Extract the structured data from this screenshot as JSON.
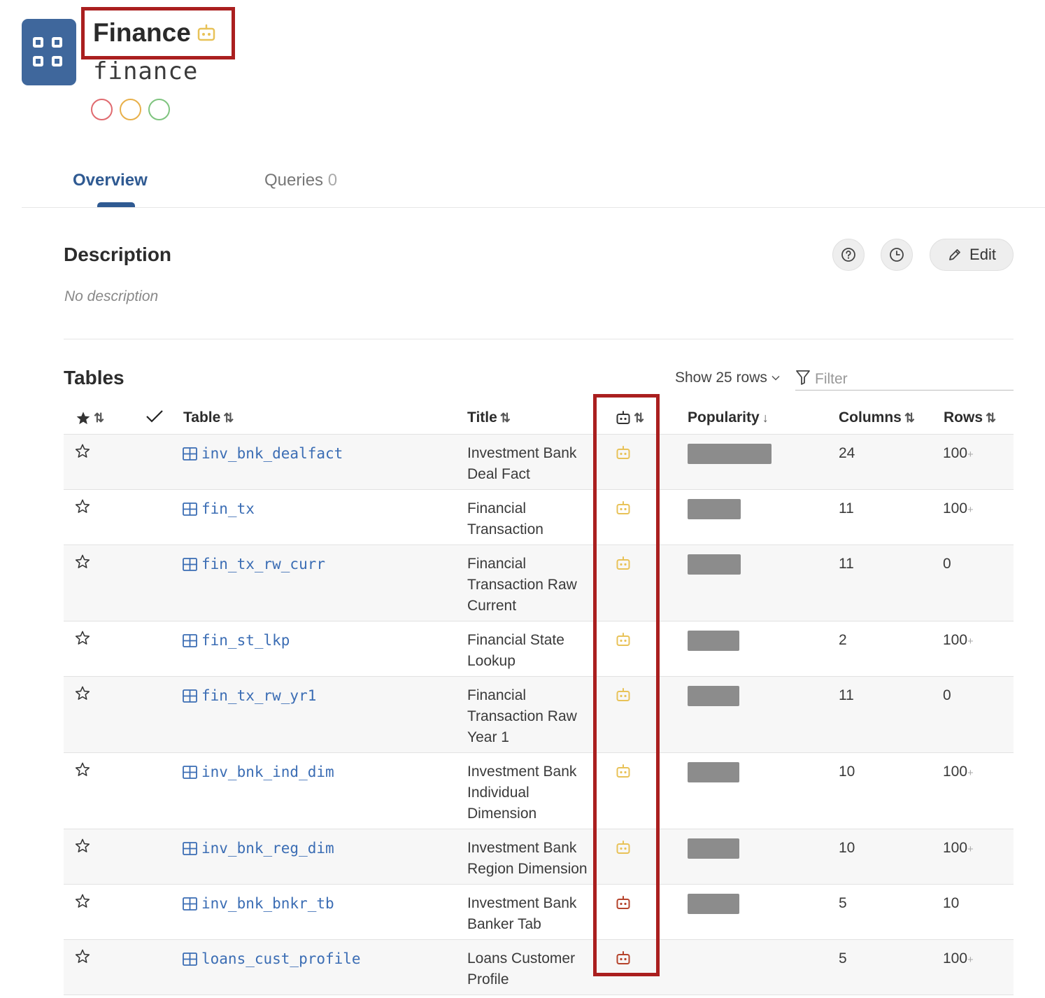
{
  "header": {
    "title": "Finance",
    "subtitle": "finance",
    "status_colors": [
      "#e06a6f",
      "#e8b04a",
      "#7fc47f"
    ],
    "ai_icon_color": "#e8c258"
  },
  "tabs": [
    {
      "label": "Overview",
      "count": ""
    },
    {
      "label": "Queries",
      "count": "0"
    }
  ],
  "description": {
    "title": "Description",
    "empty_text": "No description",
    "edit_label": "Edit"
  },
  "tables_section": {
    "title": "Tables",
    "show_rows_label": "Show 25 rows",
    "filter_placeholder": "Filter",
    "columns": {
      "table": "Table",
      "title": "Title",
      "popularity": "Popularity",
      "columns": "Columns",
      "rows": "Rows"
    },
    "rows": [
      {
        "name": "inv_bnk_dealfact",
        "title": "Investment Bank Deal Fact",
        "bot_color": "#e8c258",
        "popularity": 1.0,
        "columns": "24",
        "rows": "100",
        "rows_plus": "+"
      },
      {
        "name": "fin_tx",
        "title": "Financial Transaction",
        "bot_color": "#e8c258",
        "popularity": 0.63,
        "columns": "11",
        "rows": "100",
        "rows_plus": "+"
      },
      {
        "name": "fin_tx_rw_curr",
        "title": "Financial Transaction Raw Current",
        "bot_color": "#e8c258",
        "popularity": 0.63,
        "columns": "11",
        "rows": "0",
        "rows_plus": ""
      },
      {
        "name": "fin_st_lkp",
        "title": "Financial State Lookup",
        "bot_color": "#e8c258",
        "popularity": 0.62,
        "columns": "2",
        "rows": "100",
        "rows_plus": "+"
      },
      {
        "name": "fin_tx_rw_yr1",
        "title": "Financial Transaction Raw Year 1",
        "bot_color": "#e8c258",
        "popularity": 0.62,
        "columns": "11",
        "rows": "0",
        "rows_plus": ""
      },
      {
        "name": "inv_bnk_ind_dim",
        "title": "Investment Bank Individual Dimension",
        "bot_color": "#e8c258",
        "popularity": 0.62,
        "columns": "10",
        "rows": "100",
        "rows_plus": "+"
      },
      {
        "name": "inv_bnk_reg_dim",
        "title": "Investment Bank Region Dimension",
        "bot_color": "#e8c258",
        "popularity": 0.62,
        "columns": "10",
        "rows": "100",
        "rows_plus": "+"
      },
      {
        "name": "inv_bnk_bnkr_tb",
        "title": "Investment Bank Banker Tab",
        "bot_color": "#b5432b",
        "popularity": 0.62,
        "columns": "5",
        "rows": "10",
        "rows_plus": ""
      },
      {
        "name": "loans_cust_profile",
        "title": "Loans Customer Profile",
        "bot_color": "#b5432b",
        "popularity": 0,
        "columns": "5",
        "rows": "100",
        "rows_plus": "+"
      }
    ]
  }
}
